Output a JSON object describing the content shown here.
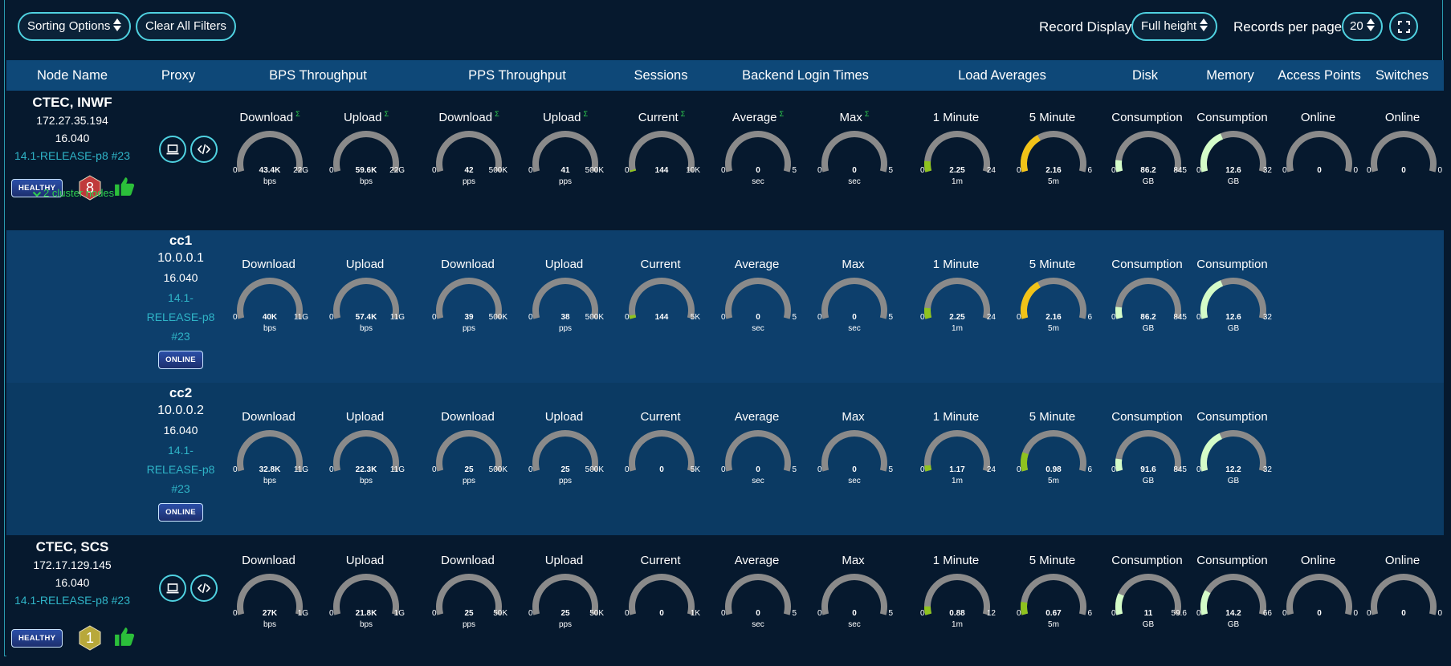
{
  "toolbar": {
    "sort_label": "Sorting Options",
    "clear_label": "Clear All Filters",
    "record_display_label": "Record Display:",
    "record_display_value": "Full height",
    "per_page_label": "Records per page:",
    "per_page_value": "20"
  },
  "headers": [
    "Node Name",
    "Proxy",
    "BPS Throughput",
    "PPS Throughput",
    "Sessions",
    "Backend Login Times",
    "Load Averages",
    "Disk",
    "Memory",
    "Access Points",
    "Switches"
  ],
  "colors": {
    "gauge_track": "#8a8a8a",
    "green": "#8fc31f",
    "yellow": "#f2c318",
    "mint": "#d4fcc8"
  },
  "rows": [
    {
      "kind": "parent",
      "name": "CTEC, INWF",
      "ip": "172.27.35.194",
      "version": "16.040",
      "release": "14.1-RELEASE-p8 #23",
      "status": "HEALTHY",
      "hex_value": "8",
      "hex_color": "#c0393b",
      "cluster_toggle": "2 cluster nodes",
      "gauges": [
        {
          "title": "Download",
          "sigma": "Σ",
          "value": "43.4K",
          "min": "0",
          "max": "22G",
          "unit": "bps",
          "frac": 0,
          "color": "#8fc31f"
        },
        {
          "title": "Upload",
          "sigma": "Σ",
          "value": "59.6K",
          "min": "0",
          "max": "22G",
          "unit": "bps",
          "frac": 0,
          "color": "#8fc31f"
        },
        {
          "title": "Download",
          "sigma": "Σ",
          "value": "42",
          "min": "0",
          "max": "500K",
          "unit": "pps",
          "frac": 0,
          "color": "#8fc31f"
        },
        {
          "title": "Upload",
          "sigma": "Σ",
          "value": "41",
          "min": "0",
          "max": "500K",
          "unit": "pps",
          "frac": 0,
          "color": "#8fc31f"
        },
        {
          "title": "Current",
          "sigma": "Σ",
          "value": "144",
          "min": "0",
          "max": "10K",
          "unit": "",
          "frac": 0.014,
          "color": "#8fc31f"
        },
        {
          "title": "Average",
          "sigma": "Σ",
          "value": "0",
          "min": "0",
          "max": "5",
          "unit": "sec",
          "frac": 0,
          "color": "#8fc31f"
        },
        {
          "title": "Max",
          "sigma": "Σ",
          "value": "0",
          "min": "0",
          "max": "5",
          "unit": "sec",
          "frac": 0,
          "color": "#8fc31f"
        },
        {
          "title": "1 Minute",
          "sigma": "",
          "value": "2.25",
          "min": "0",
          "max": "24",
          "unit": "1m",
          "frac": 0.094,
          "color": "#8fc31f"
        },
        {
          "title": "5 Minute",
          "sigma": "",
          "value": "2.16",
          "min": "0",
          "max": "6",
          "unit": "5m",
          "frac": 0.36,
          "color": "#f2c318"
        },
        {
          "title": "Consumption",
          "sigma": "",
          "value": "86.2",
          "min": "0",
          "max": "845",
          "unit": "GB",
          "frac": 0.102,
          "color": "#d4fcc8"
        },
        {
          "title": "Consumption",
          "sigma": "",
          "value": "12.6",
          "min": "0",
          "max": "32",
          "unit": "GB",
          "frac": 0.39,
          "color": "#d4fcc8"
        },
        {
          "title": "Online",
          "sigma": "",
          "value": "0",
          "min": "0",
          "max": "0",
          "unit": "",
          "frac": 0,
          "color": "#8fc31f"
        },
        {
          "title": "Online",
          "sigma": "",
          "value": "0",
          "min": "0",
          "max": "0",
          "unit": "",
          "frac": 0,
          "color": "#8fc31f"
        }
      ]
    },
    {
      "kind": "child",
      "name": "cc1",
      "ip": "10.0.0.1",
      "version": "16.040",
      "release": "14.1-RELEASE-p8 #23",
      "status": "ONLINE",
      "gauges": [
        {
          "title": "Download",
          "sigma": "",
          "value": "40K",
          "min": "0",
          "max": "11G",
          "unit": "bps",
          "frac": 0,
          "color": "#8fc31f"
        },
        {
          "title": "Upload",
          "sigma": "",
          "value": "57.4K",
          "min": "0",
          "max": "11G",
          "unit": "bps",
          "frac": 0,
          "color": "#8fc31f"
        },
        {
          "title": "Download",
          "sigma": "",
          "value": "39",
          "min": "0",
          "max": "500K",
          "unit": "pps",
          "frac": 0,
          "color": "#8fc31f"
        },
        {
          "title": "Upload",
          "sigma": "",
          "value": "38",
          "min": "0",
          "max": "500K",
          "unit": "pps",
          "frac": 0,
          "color": "#8fc31f"
        },
        {
          "title": "Current",
          "sigma": "",
          "value": "144",
          "min": "0",
          "max": "5K",
          "unit": "",
          "frac": 0.029,
          "color": "#8fc31f"
        },
        {
          "title": "Average",
          "sigma": "",
          "value": "0",
          "min": "0",
          "max": "5",
          "unit": "sec",
          "frac": 0,
          "color": "#8fc31f"
        },
        {
          "title": "Max",
          "sigma": "",
          "value": "0",
          "min": "0",
          "max": "5",
          "unit": "sec",
          "frac": 0,
          "color": "#8fc31f"
        },
        {
          "title": "1 Minute",
          "sigma": "",
          "value": "2.25",
          "min": "0",
          "max": "24",
          "unit": "1m",
          "frac": 0.094,
          "color": "#8fc31f"
        },
        {
          "title": "5 Minute",
          "sigma": "",
          "value": "2.16",
          "min": "0",
          "max": "6",
          "unit": "5m",
          "frac": 0.36,
          "color": "#f2c318"
        },
        {
          "title": "Consumption",
          "sigma": "",
          "value": "86.2",
          "min": "0",
          "max": "845",
          "unit": "GB",
          "frac": 0.102,
          "color": "#d4fcc8"
        },
        {
          "title": "Consumption",
          "sigma": "",
          "value": "12.6",
          "min": "0",
          "max": "32",
          "unit": "GB",
          "frac": 0.39,
          "color": "#d4fcc8"
        }
      ]
    },
    {
      "kind": "child",
      "name": "cc2",
      "ip": "10.0.0.2",
      "version": "16.040",
      "release": "14.1-RELEASE-p8 #23",
      "status": "ONLINE",
      "gauges": [
        {
          "title": "Download",
          "sigma": "",
          "value": "32.8K",
          "min": "0",
          "max": "11G",
          "unit": "bps",
          "frac": 0,
          "color": "#8fc31f"
        },
        {
          "title": "Upload",
          "sigma": "",
          "value": "22.3K",
          "min": "0",
          "max": "11G",
          "unit": "bps",
          "frac": 0,
          "color": "#8fc31f"
        },
        {
          "title": "Download",
          "sigma": "",
          "value": "25",
          "min": "0",
          "max": "500K",
          "unit": "pps",
          "frac": 0,
          "color": "#8fc31f"
        },
        {
          "title": "Upload",
          "sigma": "",
          "value": "25",
          "min": "0",
          "max": "500K",
          "unit": "pps",
          "frac": 0,
          "color": "#8fc31f"
        },
        {
          "title": "Current",
          "sigma": "",
          "value": "0",
          "min": "0",
          "max": "5K",
          "unit": "",
          "frac": 0,
          "color": "#8fc31f"
        },
        {
          "title": "Average",
          "sigma": "",
          "value": "0",
          "min": "0",
          "max": "5",
          "unit": "sec",
          "frac": 0,
          "color": "#8fc31f"
        },
        {
          "title": "Max",
          "sigma": "",
          "value": "0",
          "min": "0",
          "max": "5",
          "unit": "sec",
          "frac": 0,
          "color": "#8fc31f"
        },
        {
          "title": "1 Minute",
          "sigma": "",
          "value": "1.17",
          "min": "0",
          "max": "24",
          "unit": "1m",
          "frac": 0.049,
          "color": "#8fc31f"
        },
        {
          "title": "5 Minute",
          "sigma": "",
          "value": "0.98",
          "min": "0",
          "max": "6",
          "unit": "5m",
          "frac": 0.163,
          "color": "#8fc31f"
        },
        {
          "title": "Consumption",
          "sigma": "",
          "value": "91.6",
          "min": "0",
          "max": "845",
          "unit": "GB",
          "frac": 0.108,
          "color": "#d4fcc8"
        },
        {
          "title": "Consumption",
          "sigma": "",
          "value": "12.2",
          "min": "0",
          "max": "32",
          "unit": "GB",
          "frac": 0.38,
          "color": "#d4fcc8"
        }
      ]
    },
    {
      "kind": "parent",
      "name": "CTEC, SCS",
      "ip": "172.17.129.145",
      "version": "16.040",
      "release": "14.1-RELEASE-p8 #23",
      "status": "HEALTHY",
      "hex_value": "1",
      "hex_color": "#b8a83a",
      "gauges": [
        {
          "title": "Download",
          "sigma": "",
          "value": "27K",
          "min": "0",
          "max": "1G",
          "unit": "bps",
          "frac": 0,
          "color": "#8fc31f"
        },
        {
          "title": "Upload",
          "sigma": "",
          "value": "21.8K",
          "min": "0",
          "max": "1G",
          "unit": "bps",
          "frac": 0,
          "color": "#8fc31f"
        },
        {
          "title": "Download",
          "sigma": "",
          "value": "25",
          "min": "0",
          "max": "50K",
          "unit": "pps",
          "frac": 0,
          "color": "#8fc31f"
        },
        {
          "title": "Upload",
          "sigma": "",
          "value": "25",
          "min": "0",
          "max": "50K",
          "unit": "pps",
          "frac": 0,
          "color": "#8fc31f"
        },
        {
          "title": "Current",
          "sigma": "",
          "value": "0",
          "min": "0",
          "max": "1K",
          "unit": "",
          "frac": 0,
          "color": "#8fc31f"
        },
        {
          "title": "Average",
          "sigma": "",
          "value": "0",
          "min": "0",
          "max": "5",
          "unit": "sec",
          "frac": 0,
          "color": "#8fc31f"
        },
        {
          "title": "Max",
          "sigma": "",
          "value": "0",
          "min": "0",
          "max": "5",
          "unit": "sec",
          "frac": 0,
          "color": "#8fc31f"
        },
        {
          "title": "1 Minute",
          "sigma": "",
          "value": "0.88",
          "min": "0",
          "max": "12",
          "unit": "1m",
          "frac": 0.073,
          "color": "#8fc31f"
        },
        {
          "title": "5 Minute",
          "sigma": "",
          "value": "0.67",
          "min": "0",
          "max": "6",
          "unit": "5m",
          "frac": 0.112,
          "color": "#8fc31f"
        },
        {
          "title": "Consumption",
          "sigma": "",
          "value": "11",
          "min": "0",
          "max": "59.6",
          "unit": "GB",
          "frac": 0.185,
          "color": "#d4fcc8"
        },
        {
          "title": "Consumption",
          "sigma": "",
          "value": "14.2",
          "min": "0",
          "max": "66",
          "unit": "GB",
          "frac": 0.215,
          "color": "#d4fcc8"
        },
        {
          "title": "Online",
          "sigma": "",
          "value": "0",
          "min": "0",
          "max": "0",
          "unit": "",
          "frac": 0,
          "color": "#8fc31f"
        },
        {
          "title": "Online",
          "sigma": "",
          "value": "0",
          "min": "0",
          "max": "0",
          "unit": "",
          "frac": 0,
          "color": "#8fc31f"
        }
      ]
    }
  ]
}
